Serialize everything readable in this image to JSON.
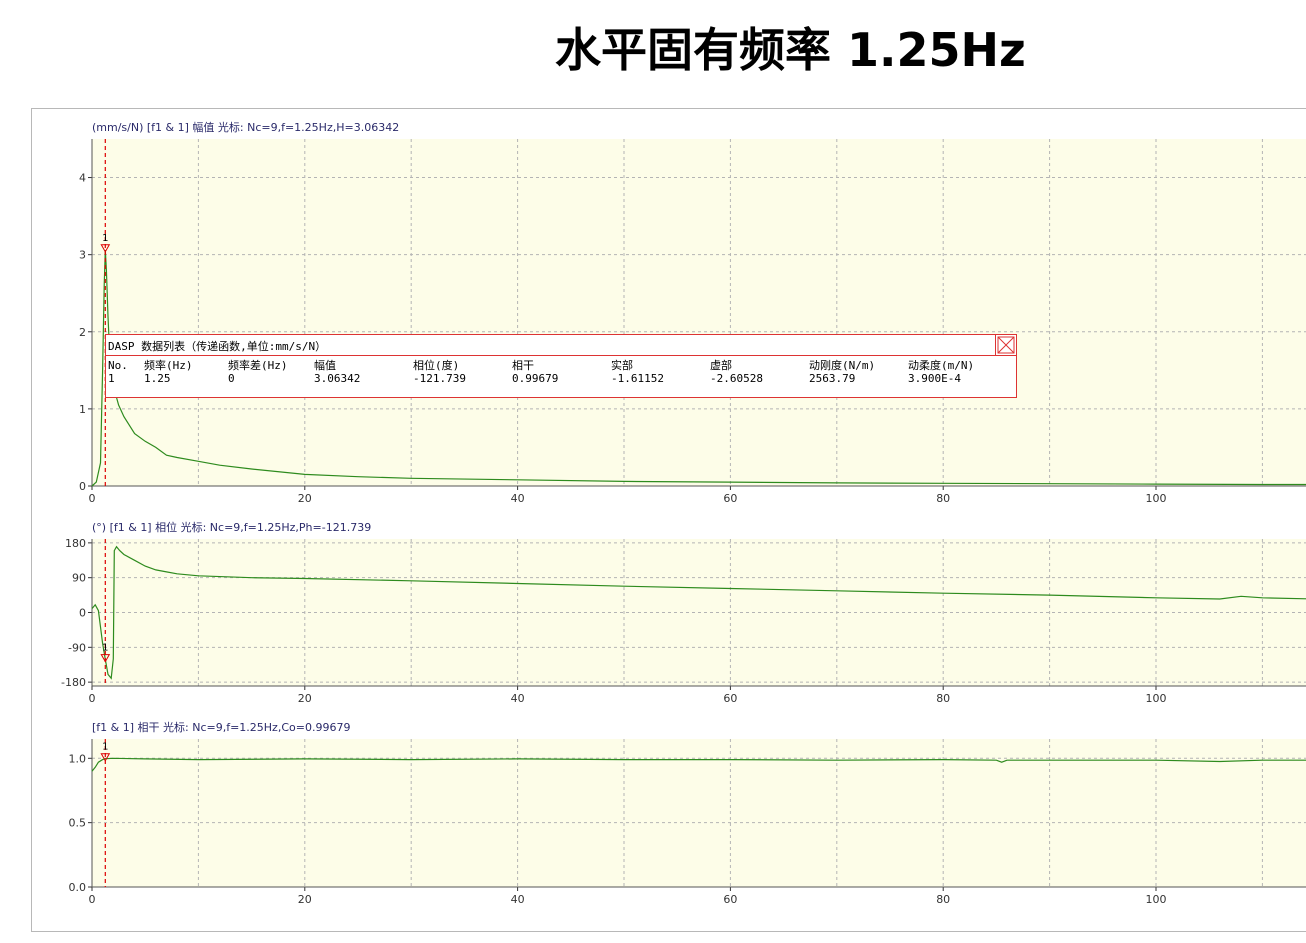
{
  "slide_title": "水平固有频率 1.25Hz",
  "colors": {
    "plot_bg": "#fdfde8",
    "trace": "#2e8b1e",
    "cursor": "#dd0000",
    "grid": "#b4b4b4"
  },
  "chart_data": [
    {
      "type": "line",
      "title": "(mm/s/N)  [f1 & 1]  幅值   光标: Nc=9,f=1.25Hz,H=3.06342",
      "xlim": [
        0,
        115
      ],
      "ylim": [
        0,
        4.5
      ],
      "x_ticks": [
        "0",
        "20",
        "40",
        "60",
        "80",
        "100"
      ],
      "y_ticks": [
        "0",
        "1",
        "2",
        "3",
        "4"
      ],
      "grid": true,
      "cursor": {
        "x": 1.25,
        "y": 3.06342,
        "label": "1"
      },
      "series": [
        {
          "x": [
            0,
            0.4,
            0.8,
            1.0,
            1.15,
            1.25,
            1.35,
            1.5,
            1.7,
            2,
            2.5,
            3,
            4,
            5,
            6,
            7,
            8,
            10,
            12,
            15,
            20,
            25,
            30,
            40,
            50,
            60,
            70,
            80,
            90,
            100,
            110,
            115
          ],
          "y": [
            0,
            0.05,
            0.3,
            1.5,
            2.6,
            3.06,
            2.8,
            2.2,
            1.6,
            1.3,
            1.05,
            0.9,
            0.68,
            0.58,
            0.5,
            0.4,
            0.37,
            0.32,
            0.27,
            0.22,
            0.15,
            0.12,
            0.1,
            0.08,
            0.06,
            0.05,
            0.04,
            0.035,
            0.03,
            0.025,
            0.02,
            0.02
          ]
        }
      ]
    },
    {
      "type": "line",
      "title": "(°)  [f1 & 1]  相位   光标: Nc=9,f=1.25Hz,Ph=-121.739",
      "xlim": [
        0,
        115
      ],
      "ylim": [
        -190,
        190
      ],
      "x_ticks": [
        "0",
        "20",
        "40",
        "60",
        "80",
        "100"
      ],
      "y_ticks": [
        "180",
        "90",
        "0",
        "-90",
        "-180"
      ],
      "grid": true,
      "cursor": {
        "x": 1.25,
        "y": -121.739,
        "label": "1"
      },
      "series": [
        {
          "x": [
            0,
            0.3,
            0.6,
            1.0,
            1.25,
            1.5,
            1.8,
            2.0,
            2.1,
            2.3,
            2.6,
            3,
            4,
            5,
            6,
            7,
            8,
            10,
            15,
            20,
            30,
            40,
            50,
            60,
            70,
            80,
            90,
            100,
            106,
            108,
            110,
            115
          ],
          "y": [
            10,
            20,
            5,
            -80,
            -121,
            -160,
            -170,
            -120,
            160,
            170,
            160,
            150,
            135,
            120,
            110,
            105,
            100,
            95,
            90,
            88,
            82,
            75,
            68,
            62,
            56,
            50,
            45,
            38,
            35,
            42,
            38,
            35
          ]
        }
      ]
    },
    {
      "type": "line",
      "title": "[f1 & 1]  相干   光标: Nc=9,f=1.25Hz,Co=0.99679",
      "xlim": [
        0,
        115
      ],
      "ylim": [
        0,
        1.15
      ],
      "x_ticks": [
        "0",
        "20",
        "40",
        "60",
        "80",
        "100"
      ],
      "y_ticks": [
        "1.0",
        "0.5",
        "0.0"
      ],
      "grid": true,
      "cursor": {
        "x": 1.25,
        "y": 0.99679,
        "label": "1"
      },
      "series": [
        {
          "x": [
            0,
            0.3,
            0.6,
            1.0,
            1.25,
            2,
            5,
            10,
            20,
            30,
            40,
            50,
            60,
            70,
            80,
            85,
            85.5,
            86,
            90,
            100,
            106,
            110,
            115
          ],
          "y": [
            0.9,
            0.93,
            0.97,
            0.99,
            0.997,
            1.0,
            0.995,
            0.99,
            0.995,
            0.99,
            0.995,
            0.99,
            0.99,
            0.985,
            0.99,
            0.985,
            0.97,
            0.985,
            0.985,
            0.985,
            0.975,
            0.985,
            0.985
          ]
        }
      ]
    }
  ],
  "data_table": {
    "title": "DASP 数据列表（传递函数,单位:mm/s/N）",
    "headers": [
      "No.",
      "频率(Hz)",
      "频率差(Hz)",
      "幅值",
      "相位(度)",
      "相干",
      "实部",
      "虚部",
      "动刚度(N/m)",
      "动柔度(m/N)"
    ],
    "row": [
      "1",
      "1.25",
      "0",
      "3.06342",
      "-121.739",
      "0.99679",
      "-1.61152",
      "-2.60528",
      "2563.79",
      "3.900E-4"
    ]
  }
}
